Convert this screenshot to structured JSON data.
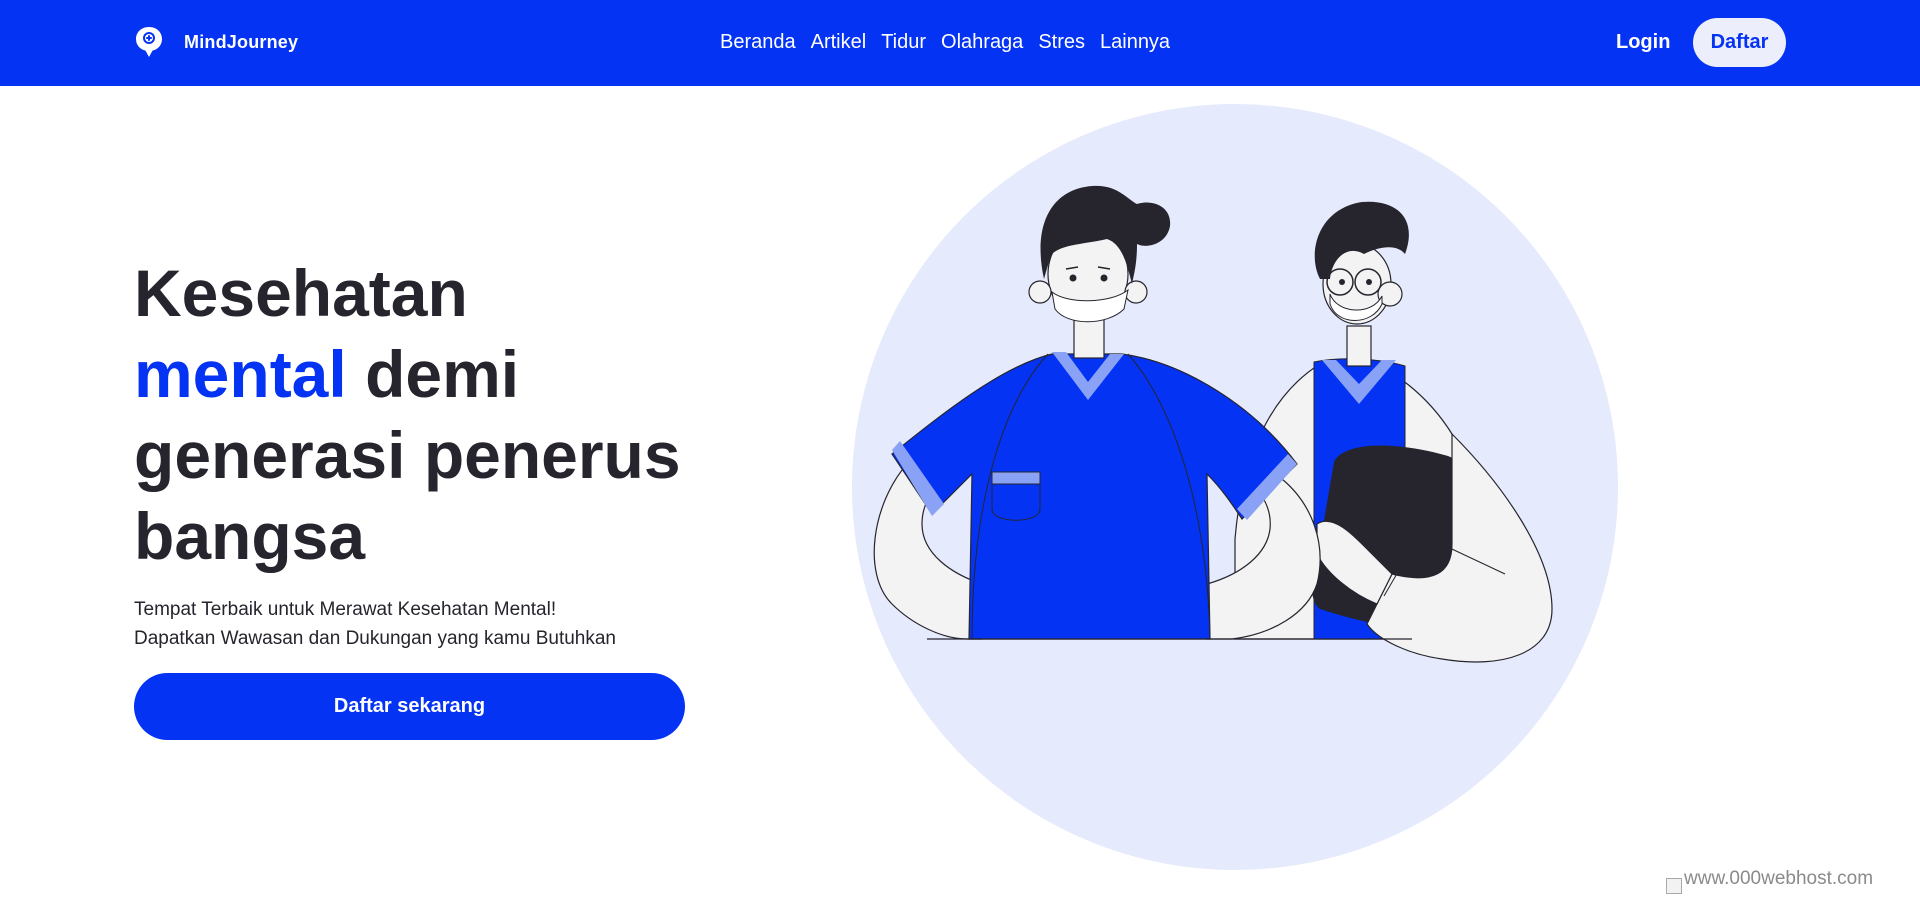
{
  "brand": {
    "name": "MindJourney",
    "logo_icon": "chat-bubble-plus-icon"
  },
  "nav": {
    "links": [
      "Beranda",
      "Artikel",
      "Tidur",
      "Olahraga",
      "Stres",
      "Lainnya"
    ],
    "login_label": "Login",
    "signup_label": "Daftar"
  },
  "hero": {
    "title_line1": "Kesehatan",
    "title_accent": "mental",
    "title_line2_rest": " demi",
    "title_line3": "generasi penerus",
    "title_line4": "bangsa",
    "subtitle_line1": "Tempat Terbaik untuk Merawat Kesehatan Mental!",
    "subtitle_line2": "Dapatkan Wawasan dan Dukungan yang kamu Butuhkan",
    "cta_label": "Daftar sekarang",
    "illustration": "two-health-workers-illustration"
  },
  "footer_badge": {
    "text": "www.000webhost.com"
  },
  "colors": {
    "primary": "#0433f4",
    "dark_text": "#26252e",
    "circle_bg": "#e5eafc",
    "pill_bg": "#eceefb",
    "scrub_trim": "#8aa2f5"
  }
}
